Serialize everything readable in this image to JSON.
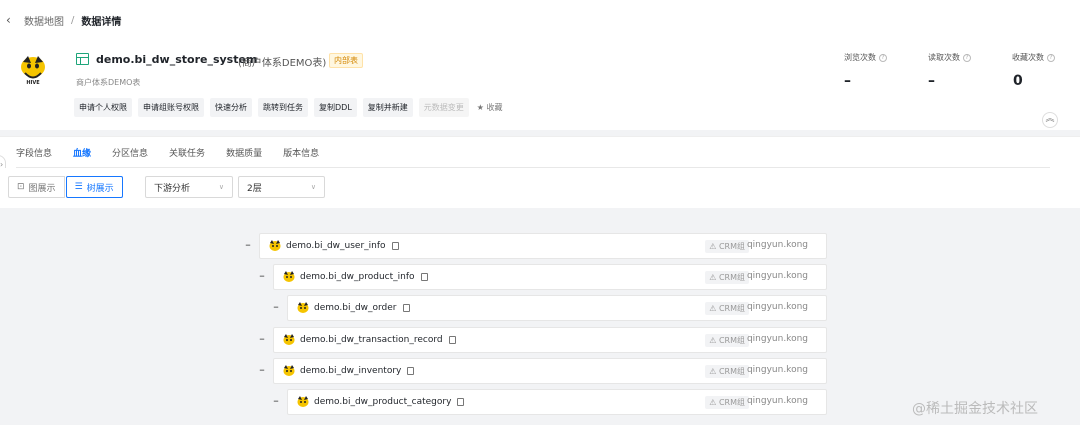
{
  "breadcrumb": {
    "back_icon": "chevron-left-icon",
    "parent": "数据地图",
    "separator": "/",
    "current": "数据详情"
  },
  "table": {
    "name": "demo.bi_dw_store_system",
    "display_name": "(商户体系DEMO表)",
    "badge": "内部表",
    "description": "商户体系DEMO表",
    "logo": "hive-logo"
  },
  "actions": [
    "申请个人权限",
    "申请组账号权限",
    "快速分析",
    "跳转到任务",
    "复制DDL",
    "复制并新建",
    "元数据变更"
  ],
  "favorite": {
    "icon": "star-icon",
    "label": "收藏"
  },
  "stats": [
    {
      "label": "浏览次数",
      "value": "–"
    },
    {
      "label": "读取次数",
      "value": "–"
    },
    {
      "label": "收藏次数",
      "value": "0"
    }
  ],
  "tabs": [
    {
      "label": "字段信息",
      "active": false
    },
    {
      "label": "血缘",
      "active": true
    },
    {
      "label": "分区信息",
      "active": false
    },
    {
      "label": "关联任务",
      "active": false
    },
    {
      "label": "数据质量",
      "active": false
    },
    {
      "label": "版本信息",
      "active": false
    }
  ],
  "toolbar": {
    "graph_view": "图展示",
    "tree_view": "树展示",
    "direction_select": "下游分析",
    "depth_select": "2层"
  },
  "lineage": [
    {
      "name": "demo.bi_dw_user_info",
      "group": "CRM组",
      "owner": "qingyun.kong",
      "level": 0
    },
    {
      "name": "demo.bi_dw_product_info",
      "group": "CRM组",
      "owner": "qingyun.kong",
      "level": 1
    },
    {
      "name": "demo.bi_dw_order",
      "group": "CRM组",
      "owner": "qingyun.kong",
      "level": 2
    },
    {
      "name": "demo.bi_dw_transaction_record",
      "group": "CRM组",
      "owner": "qingyun.kong",
      "level": 1
    },
    {
      "name": "demo.bi_dw_inventory",
      "group": "CRM组",
      "owner": "qingyun.kong",
      "level": 1
    },
    {
      "name": "demo.bi_dw_product_category",
      "group": "CRM组",
      "owner": "qingyun.kong",
      "level": 2
    }
  ],
  "watermark": "@稀土掘金技术社区",
  "colors": {
    "accent": "#1677ff",
    "badge": "#d48806",
    "table_icon": "#1ea57a"
  }
}
